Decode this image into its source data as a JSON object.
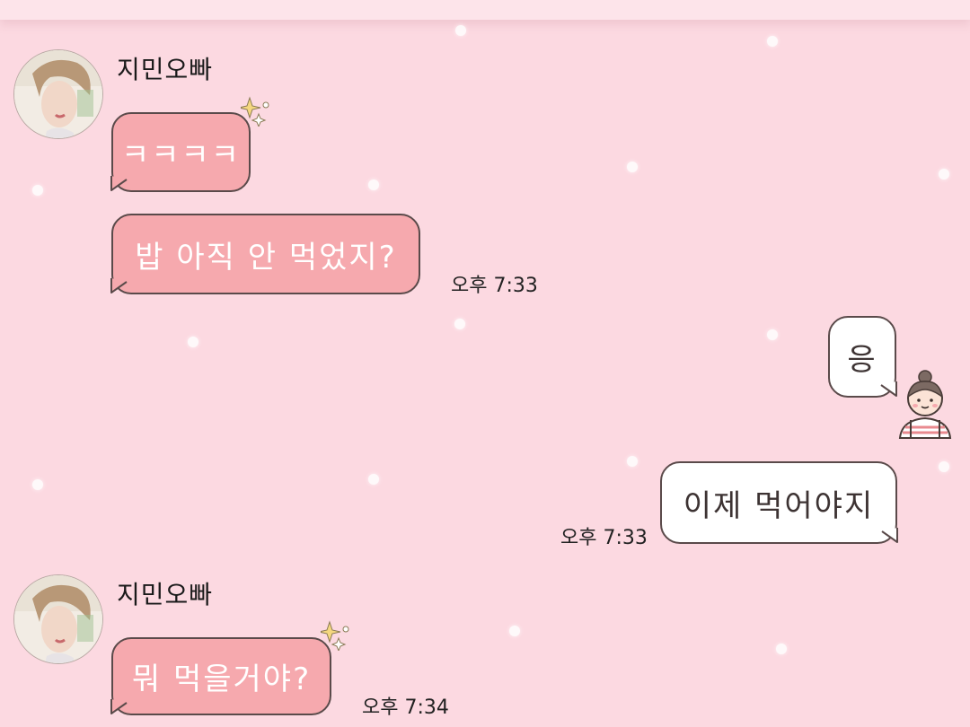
{
  "chat": {
    "messages": [
      {
        "sender": "지민오빠",
        "text": "ㅋㅋㅋㅋ"
      },
      {
        "sender": "지민오빠",
        "text": "밥 아직 안 먹었지?",
        "time": "오후 7:33"
      },
      {
        "sender": "me",
        "text": "응"
      },
      {
        "sender": "me",
        "text": "이제 먹어야지",
        "time": "오후 7:33"
      },
      {
        "sender": "지민오빠",
        "text": "뭐 먹을거야?",
        "time": "오후 7:34"
      }
    ]
  },
  "colors": {
    "background": "#fcd9e1",
    "incoming_bubble": "#f6a9ae",
    "outgoing_bubble": "#ffffff",
    "bubble_border": "#5a4a4a"
  },
  "icons": {
    "contact_avatar": "contact-avatar-photo",
    "my_avatar": "girl-character-icon",
    "sparkle": "sparkle-icon"
  }
}
